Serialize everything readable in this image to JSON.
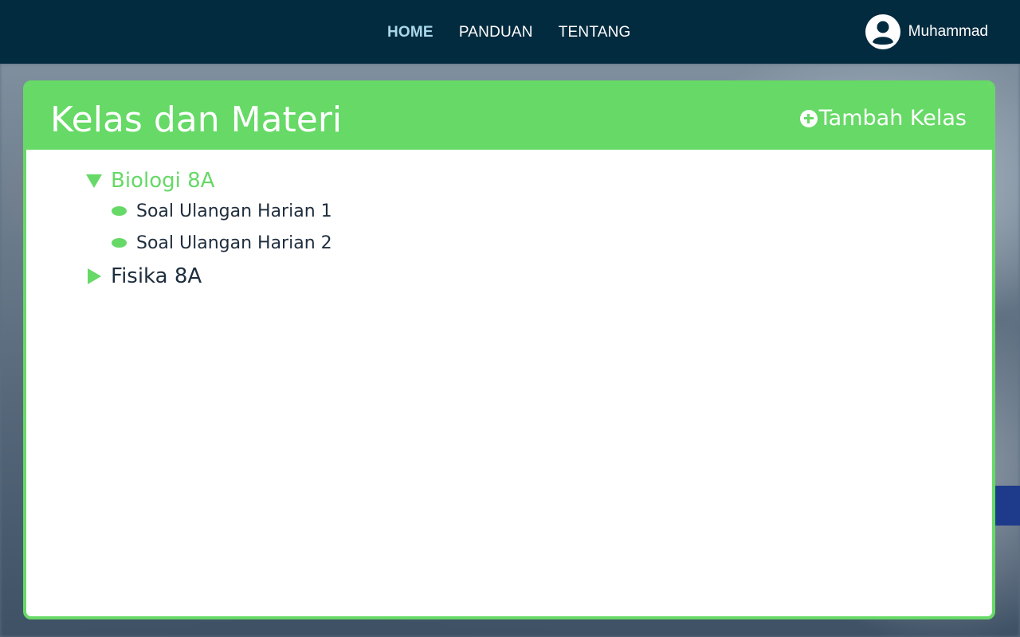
{
  "nav": {
    "links": [
      {
        "label": "HOME",
        "active": true
      },
      {
        "label": "PANDUAN",
        "active": false
      },
      {
        "label": "TENTANG",
        "active": false
      }
    ],
    "user_name": "Muhammad"
  },
  "card": {
    "title": "Kelas dan Materi",
    "add_class_label": "Tambah Kelas"
  },
  "tree": {
    "classes": [
      {
        "label": "Biologi 8A",
        "expanded": true,
        "materials": [
          "Soal Ulangan Harian 1",
          "Soal Ulangan Harian 2"
        ]
      },
      {
        "label": "Fisika 8A",
        "expanded": false,
        "materials": []
      }
    ]
  },
  "colors": {
    "navbar": "#032b3f",
    "accent": "#66d966",
    "nav_active": "#a8d8ea",
    "text_dark": "#1e2d3d"
  },
  "icons": {
    "user": "user-circle-icon",
    "add": "plus-circle-icon",
    "expanded": "triangle-down-icon",
    "collapsed": "triangle-right-icon",
    "bullet": "bullet-dot-icon"
  }
}
